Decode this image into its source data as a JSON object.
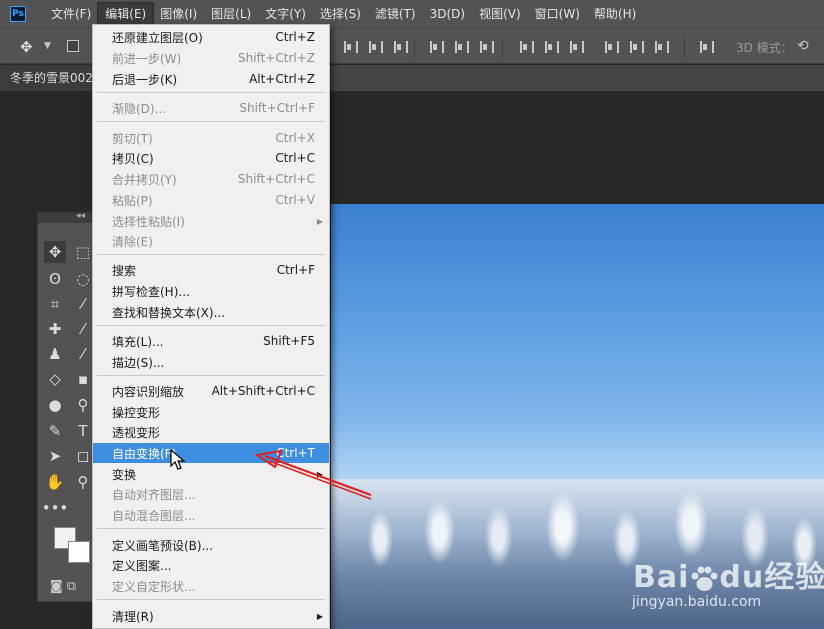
{
  "app": {
    "logo": "Ps",
    "menus": [
      "文件(F)",
      "编辑(E)",
      "图像(I)",
      "图层(L)",
      "文字(Y)",
      "选择(S)",
      "滤镜(T)",
      "3D(D)",
      "视图(V)",
      "窗口(W)",
      "帮助(H)"
    ],
    "active_menu_index": 1
  },
  "options_bar": {
    "mode_label": "3D 模式："
  },
  "document": {
    "tab_title": "冬季的雪景002"
  },
  "edit_menu": {
    "items": [
      {
        "label": "还原建立图层(O)",
        "shortcut": "Ctrl+Z",
        "enabled": true
      },
      {
        "label": "前进一步(W)",
        "shortcut": "Shift+Ctrl+Z",
        "enabled": false
      },
      {
        "label": "后退一步(K)",
        "shortcut": "Alt+Ctrl+Z",
        "enabled": true
      },
      {
        "label": "渐隐(D)...",
        "shortcut": "Shift+Ctrl+F",
        "enabled": false
      },
      {
        "label": "剪切(T)",
        "shortcut": "Ctrl+X",
        "enabled": false
      },
      {
        "label": "拷贝(C)",
        "shortcut": "Ctrl+C",
        "enabled": true
      },
      {
        "label": "合并拷贝(Y)",
        "shortcut": "Shift+Ctrl+C",
        "enabled": false
      },
      {
        "label": "粘贴(P)",
        "shortcut": "Ctrl+V",
        "enabled": false
      },
      {
        "label": "选择性粘贴(I)",
        "shortcut": "",
        "enabled": false,
        "submenu": true
      },
      {
        "label": "清除(E)",
        "shortcut": "",
        "enabled": false
      },
      {
        "label": "搜索",
        "shortcut": "Ctrl+F",
        "enabled": true
      },
      {
        "label": "拼写检查(H)...",
        "shortcut": "",
        "enabled": true
      },
      {
        "label": "查找和替换文本(X)...",
        "shortcut": "",
        "enabled": true
      },
      {
        "label": "填充(L)...",
        "shortcut": "Shift+F5",
        "enabled": true
      },
      {
        "label": "描边(S)...",
        "shortcut": "",
        "enabled": true
      },
      {
        "label": "内容识别缩放",
        "shortcut": "Alt+Shift+Ctrl+C",
        "enabled": true
      },
      {
        "label": "操控变形",
        "shortcut": "",
        "enabled": true
      },
      {
        "label": "透视变形",
        "shortcut": "",
        "enabled": true
      },
      {
        "label": "自由变换(F)",
        "shortcut": "Ctrl+T",
        "enabled": true,
        "highlighted": true
      },
      {
        "label": "变换",
        "shortcut": "",
        "enabled": true,
        "submenu": true
      },
      {
        "label": "自动对齐图层...",
        "shortcut": "",
        "enabled": false
      },
      {
        "label": "自动混合图层...",
        "shortcut": "",
        "enabled": false
      },
      {
        "label": "定义画笔预设(B)...",
        "shortcut": "",
        "enabled": true
      },
      {
        "label": "定义图案...",
        "shortcut": "",
        "enabled": true
      },
      {
        "label": "定义自定形状...",
        "shortcut": "",
        "enabled": false
      },
      {
        "label": "清理(R)",
        "shortcut": "",
        "enabled": true,
        "submenu": true
      }
    ]
  },
  "watermark": {
    "logo_text_a": "Bai",
    "logo_text_b": "du",
    "logo_text_c": "经验",
    "url": "jingyan.baidu.com"
  },
  "colors": {
    "ui_dark": "#535353",
    "highlight": "#3e8ee0",
    "annotation_arrow": "#e02020"
  }
}
